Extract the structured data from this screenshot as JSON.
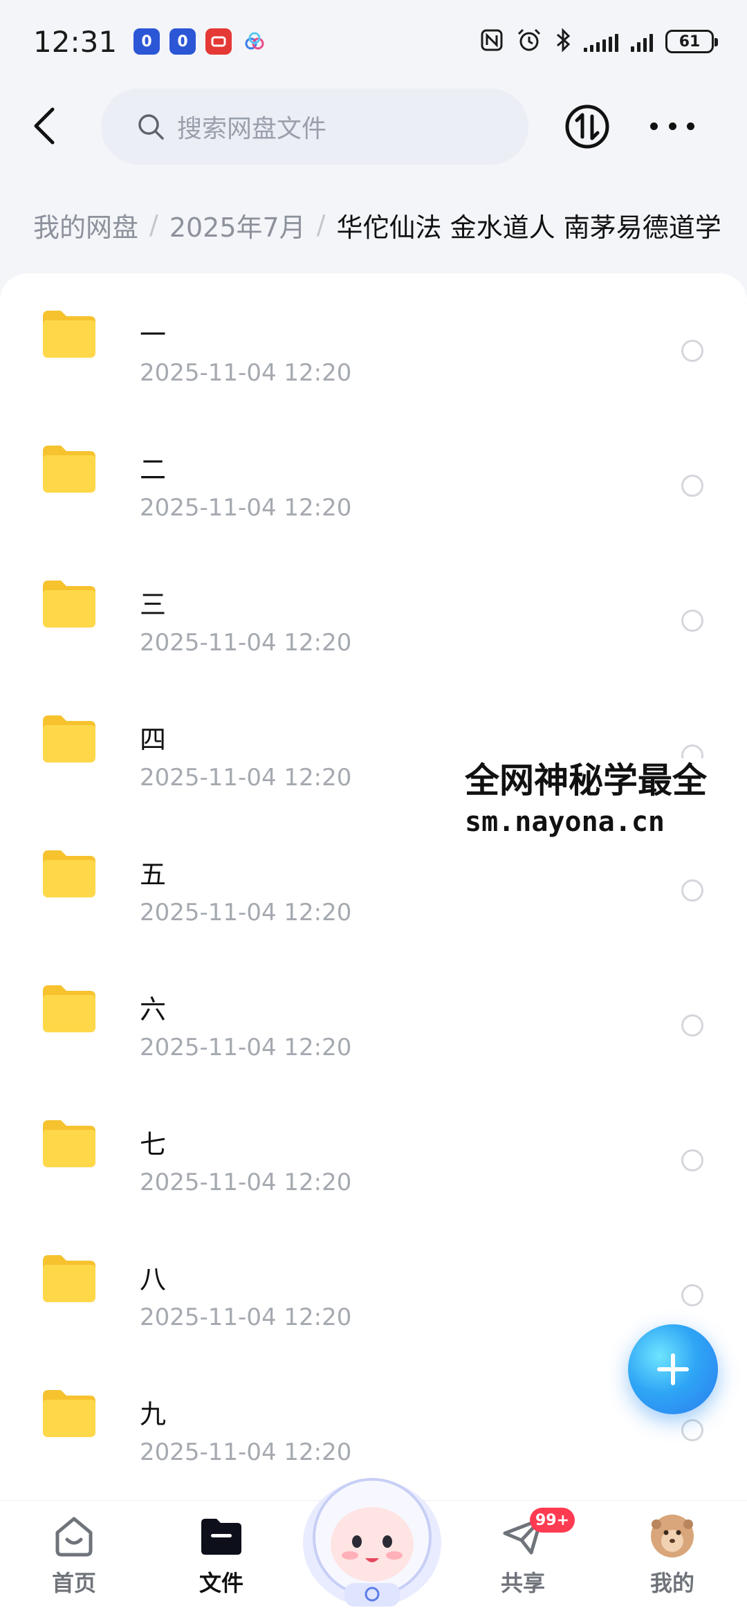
{
  "status_bar": {
    "time": "12:31",
    "app_badges": [
      "0",
      "0",
      "",
      ""
    ],
    "battery": "61"
  },
  "top_bar": {
    "search_placeholder": "搜索网盘文件"
  },
  "breadcrumb": {
    "items": [
      "我的网盘",
      "2025年7月"
    ],
    "separator": "/",
    "current": "华佗仙法 金水道人 南茅易德道学"
  },
  "files": [
    {
      "name": "一",
      "date": "2025-11-04  12:20"
    },
    {
      "name": "二",
      "date": "2025-11-04  12:20"
    },
    {
      "name": "三",
      "date": "2025-11-04  12:20"
    },
    {
      "name": "四",
      "date": "2025-11-04  12:20"
    },
    {
      "name": "五",
      "date": "2025-11-04  12:20"
    },
    {
      "name": "六",
      "date": "2025-11-04  12:20"
    },
    {
      "name": "七",
      "date": "2025-11-04  12:20"
    },
    {
      "name": "八",
      "date": "2025-11-04  12:20"
    },
    {
      "name": "九",
      "date": "2025-11-04  12:20"
    }
  ],
  "watermark": {
    "line1": "全网神秘学最全",
    "line2": "sm.nayona.cn"
  },
  "bottom_nav": {
    "home": "首页",
    "files": "文件",
    "share": "共享",
    "share_badge": "99+",
    "mine": "我的"
  },
  "colors": {
    "folder": "#ffd23f",
    "fab": "#2fa6f5",
    "badge": "#ff3b52"
  }
}
